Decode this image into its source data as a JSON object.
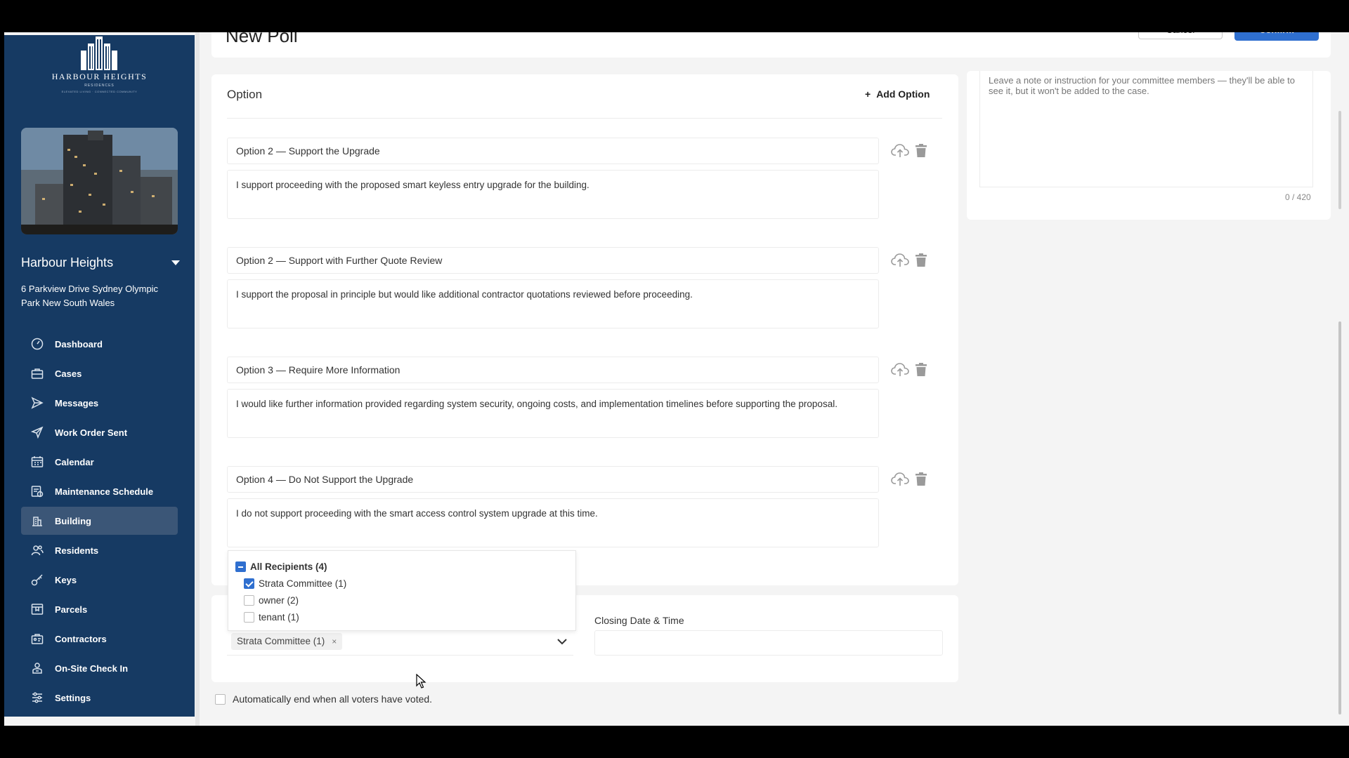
{
  "header": {
    "title": "New Poll",
    "cancel_label": "Cancel",
    "confirm_label": "Confirm"
  },
  "sidebar": {
    "logo": {
      "brand": "HARBOUR HEIGHTS",
      "sub": "RESIDENCES",
      "tag": "ELEVATED LIVING · CONNECTED COMMUNITY"
    },
    "property_name": "Harbour Heights",
    "address": "6 Parkview Drive Sydney Olympic Park New South Wales",
    "items": [
      {
        "label": "Dashboard",
        "icon": "dashboard-icon"
      },
      {
        "label": "Cases",
        "icon": "briefcase-icon"
      },
      {
        "label": "Messages",
        "icon": "send-icon"
      },
      {
        "label": "Work Order Sent",
        "icon": "paper-plane-icon"
      },
      {
        "label": "Calendar",
        "icon": "calendar-icon"
      },
      {
        "label": "Maintenance Schedule",
        "icon": "maintenance-icon"
      },
      {
        "label": "Building",
        "icon": "building-icon",
        "active": true
      },
      {
        "label": "Residents",
        "icon": "residents-icon"
      },
      {
        "label": "Keys",
        "icon": "key-icon"
      },
      {
        "label": "Parcels",
        "icon": "parcel-icon"
      },
      {
        "label": "Contractors",
        "icon": "contractor-icon"
      },
      {
        "label": "On-Site Check In",
        "icon": "check-in-icon"
      },
      {
        "label": "Settings",
        "icon": "settings-icon"
      }
    ]
  },
  "options": {
    "heading": "Option",
    "add_label": "Add Option",
    "items": [
      {
        "title": "Option 2 — Support the Upgrade",
        "description": "I support proceeding with the proposed smart keyless entry upgrade for the building."
      },
      {
        "title": "Option 2 — Support with Further Quote Review",
        "description": "I support the proposal in principle but would like additional contractor quotations reviewed before proceeding."
      },
      {
        "title": "Option 3 — Require More Information",
        "description": "I would like further information provided regarding system security, ongoing costs, and implementation timelines before supporting the proposal."
      },
      {
        "title": "Option 4 — Do Not Support the Upgrade",
        "description": "I do not support proceeding with the smart access control system upgrade at this time."
      }
    ]
  },
  "recipients": {
    "options": [
      {
        "label": "All Recipients (4)",
        "state": "indeterminate"
      },
      {
        "label": "Strata Committee (1)",
        "state": "checked"
      },
      {
        "label": "owner (2)",
        "state": "unchecked"
      },
      {
        "label": "tenant (1)",
        "state": "unchecked"
      }
    ],
    "selected_tag": "Strata Committee (1)",
    "remove_glyph": "×"
  },
  "closing": {
    "label": "Closing Date & Time",
    "value": ""
  },
  "auto_end": {
    "label": "Automatically end when all voters have voted.",
    "checked": false
  },
  "notes": {
    "placeholder": "Leave a note or instruction for your committee members — they'll be able to see it, but it won't be added to the case.",
    "count": "0 / 420"
  },
  "colors": {
    "sidebar": "#163a63",
    "accent": "#2f6fcf",
    "active_nav": "#3b5677"
  }
}
